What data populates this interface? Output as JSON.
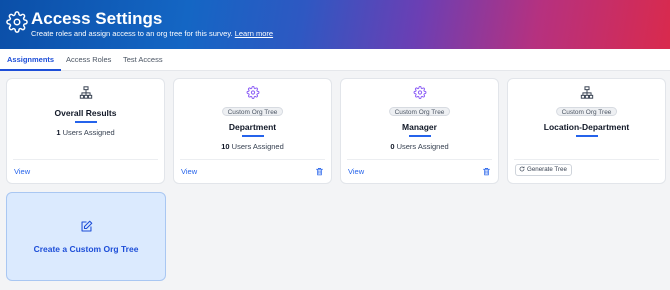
{
  "header": {
    "title": "Access Settings",
    "subtitle": "Create roles and assign access to an org tree for this survey.",
    "learn_more": "Learn more",
    "icon": "gear-icon"
  },
  "tabs": [
    {
      "label": "Assignments",
      "active": true
    },
    {
      "label": "Access Roles",
      "active": false
    },
    {
      "label": "Test Access",
      "active": false
    }
  ],
  "cards": [
    {
      "icon": "org-tree-icon",
      "badge": "",
      "title": "Overall Results",
      "count": "1",
      "count_label": "Users Assigned",
      "view": "View"
    },
    {
      "icon": "gear-icon",
      "badge": "Custom Org Tree",
      "title": "Department",
      "count": "10",
      "count_label": "Users Assigned",
      "view": "View",
      "delete_icon": "trash-icon"
    },
    {
      "icon": "gear-icon",
      "badge": "Custom Org Tree",
      "title": "Manager",
      "count": "0",
      "count_label": "Users Assigned",
      "view": "View",
      "delete_icon": "trash-icon"
    },
    {
      "icon": "org-tree-icon",
      "badge": "Custom Org Tree",
      "title": "Location-Department",
      "action": "Generate Tree",
      "action_icon": "refresh-icon"
    }
  ],
  "create_card": {
    "icon": "edit-icon",
    "label": "Create a Custom Org Tree"
  },
  "colors": {
    "accent": "#2563eb",
    "gear_icon": "#8b5cf6",
    "create_bg": "#dbeafe",
    "banner_start": "#0b4fa8",
    "banner_end": "#d92a4d"
  }
}
